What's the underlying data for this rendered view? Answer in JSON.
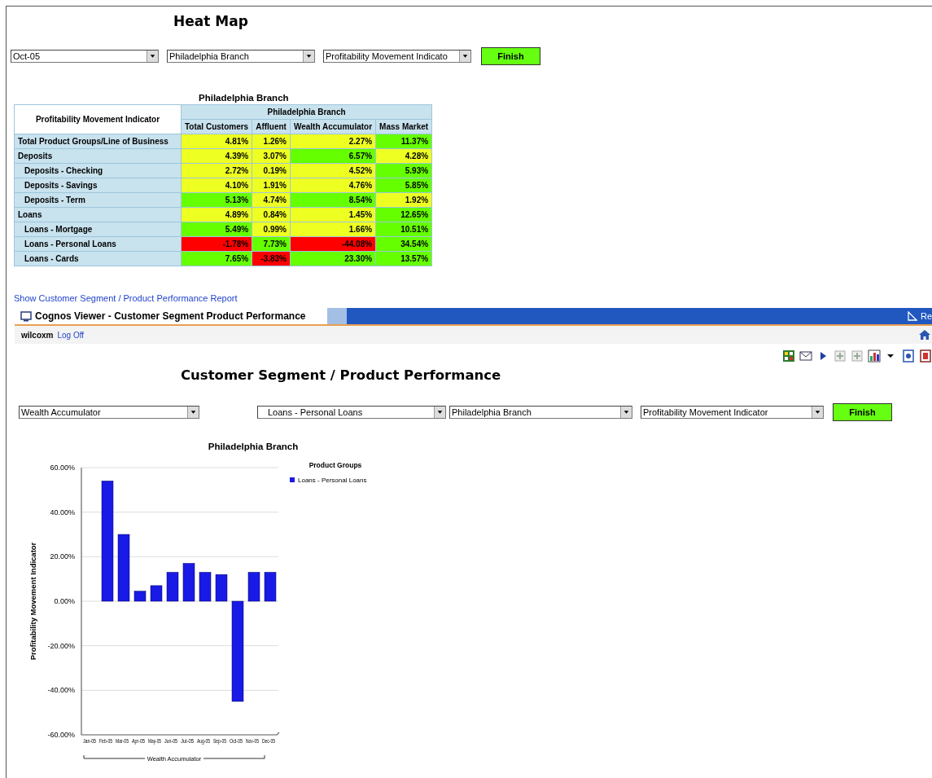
{
  "heat_map": {
    "title": "Heat Map",
    "prompts": [
      {
        "value": "Oct-05"
      },
      {
        "value": "Philadelphia Branch"
      },
      {
        "value": "Profitability Movement Indicato"
      }
    ],
    "finish_button": "Finish",
    "table_title": "Philadelphia Branch",
    "table": {
      "corner": "Profitability Movement Indicator",
      "group_header": "Philadelphia Branch",
      "columns": [
        "Total Customers",
        "Affluent",
        "Wealth Accumulator",
        "Mass Market"
      ],
      "rows": [
        {
          "label": "Total Product Groups/Line of Business",
          "cells": [
            {
              "text": "4.81%",
              "color": "#eeff22"
            },
            {
              "text": "1.26%",
              "color": "#eeff22"
            },
            {
              "text": "2.27%",
              "color": "#eeff22"
            },
            {
              "text": "11.37%",
              "color": "#66ff00"
            }
          ]
        },
        {
          "label": "Deposits",
          "cells": [
            {
              "text": "4.39%",
              "color": "#eeff22"
            },
            {
              "text": "3.07%",
              "color": "#eeff22"
            },
            {
              "text": "6.57%",
              "color": "#66ff00"
            },
            {
              "text": "4.28%",
              "color": "#eeff22"
            }
          ],
          "children": [
            {
              "label": "Deposits - Checking",
              "cells": [
                {
                  "text": "2.72%",
                  "color": "#eeff22"
                },
                {
                  "text": "0.19%",
                  "color": "#eeff22"
                },
                {
                  "text": "4.52%",
                  "color": "#eeff22"
                },
                {
                  "text": "5.93%",
                  "color": "#66ff00"
                }
              ]
            },
            {
              "label": "Deposits - Savings",
              "cells": [
                {
                  "text": "4.10%",
                  "color": "#eeff22"
                },
                {
                  "text": "1.91%",
                  "color": "#eeff22"
                },
                {
                  "text": "4.76%",
                  "color": "#eeff22"
                },
                {
                  "text": "5.85%",
                  "color": "#66ff00"
                }
              ]
            },
            {
              "label": "Deposits - Term",
              "cells": [
                {
                  "text": "5.13%",
                  "color": "#66ff00"
                },
                {
                  "text": "4.74%",
                  "color": "#eeff22"
                },
                {
                  "text": "8.54%",
                  "color": "#66ff00"
                },
                {
                  "text": "1.92%",
                  "color": "#eeff22"
                }
              ]
            }
          ]
        },
        {
          "label": "Loans",
          "cells": [
            {
              "text": "4.89%",
              "color": "#eeff22"
            },
            {
              "text": "0.84%",
              "color": "#eeff22"
            },
            {
              "text": "1.45%",
              "color": "#eeff22"
            },
            {
              "text": "12.65%",
              "color": "#66ff00"
            }
          ],
          "children": [
            {
              "label": "Loans - Mortgage",
              "cells": [
                {
                  "text": "5.49%",
                  "color": "#66ff00"
                },
                {
                  "text": "0.99%",
                  "color": "#eeff22"
                },
                {
                  "text": "1.66%",
                  "color": "#eeff22"
                },
                {
                  "text": "10.51%",
                  "color": "#66ff00"
                }
              ]
            },
            {
              "label": "Loans - Personal Loans",
              "cells": [
                {
                  "text": "-1.78%",
                  "color": "#ff0000"
                },
                {
                  "text": "7.73%",
                  "color": "#66ff00"
                },
                {
                  "text": "-44.08%",
                  "color": "#ff0000"
                },
                {
                  "text": "34.54%",
                  "color": "#66ff00"
                }
              ]
            },
            {
              "label": "Loans - Cards",
              "cells": [
                {
                  "text": "7.65%",
                  "color": "#66ff00"
                },
                {
                  "text": "-3.83%",
                  "color": "#ff0000"
                },
                {
                  "text": "23.30%",
                  "color": "#66ff00"
                },
                {
                  "text": "13.57%",
                  "color": "#66ff00"
                }
              ]
            }
          ]
        }
      ]
    }
  },
  "report_link": "Show Customer Segment / Product Performance Report",
  "viewer": {
    "title": "Cognos Viewer - Customer Segment Product Performance",
    "right_text": "Re",
    "user": "wilcoxm",
    "log_off": "Log Off"
  },
  "report": {
    "title": "Customer Segment / Product Performance",
    "prompts": [
      {
        "value": "Wealth Accumulator"
      },
      {
        "value": "Loans - Personal Loans"
      },
      {
        "value": "Philadelphia Branch"
      },
      {
        "value": "Profitability Movement Indicator"
      }
    ],
    "finish_button": "Finish",
    "legend_title": "Product Groups",
    "chart_data": {
      "type": "bar",
      "title": "Philadelphia Branch",
      "xlabel": "Wealth Accumulator",
      "ylabel": "Profitability Movement Indicator",
      "categories": [
        "Jan-05",
        "Feb-05",
        "Mar-05",
        "Apr-05",
        "May-05",
        "Jun-05",
        "Jul-05",
        "Aug-05",
        "Sep-05",
        "Oct-05",
        "Nov-05",
        "Dec-05"
      ],
      "series": [
        {
          "name": "Loans - Personal Loans",
          "color": "#1a1ae6",
          "values": [
            null,
            54,
            30,
            4.5,
            7,
            13,
            17,
            13,
            12,
            -45,
            13,
            13
          ]
        }
      ],
      "ylim": [
        -60,
        60
      ],
      "grid": true,
      "yticks": [
        {
          "value": 60,
          "label": "60.00%"
        },
        {
          "value": 40,
          "label": "40.00%"
        },
        {
          "value": 20,
          "label": "20.00%"
        },
        {
          "value": 0,
          "label": "0.00%"
        },
        {
          "value": -20,
          "label": "-20.00%"
        },
        {
          "value": -40,
          "label": "-40.00%"
        },
        {
          "value": -60,
          "label": "-60.00%"
        }
      ]
    }
  }
}
